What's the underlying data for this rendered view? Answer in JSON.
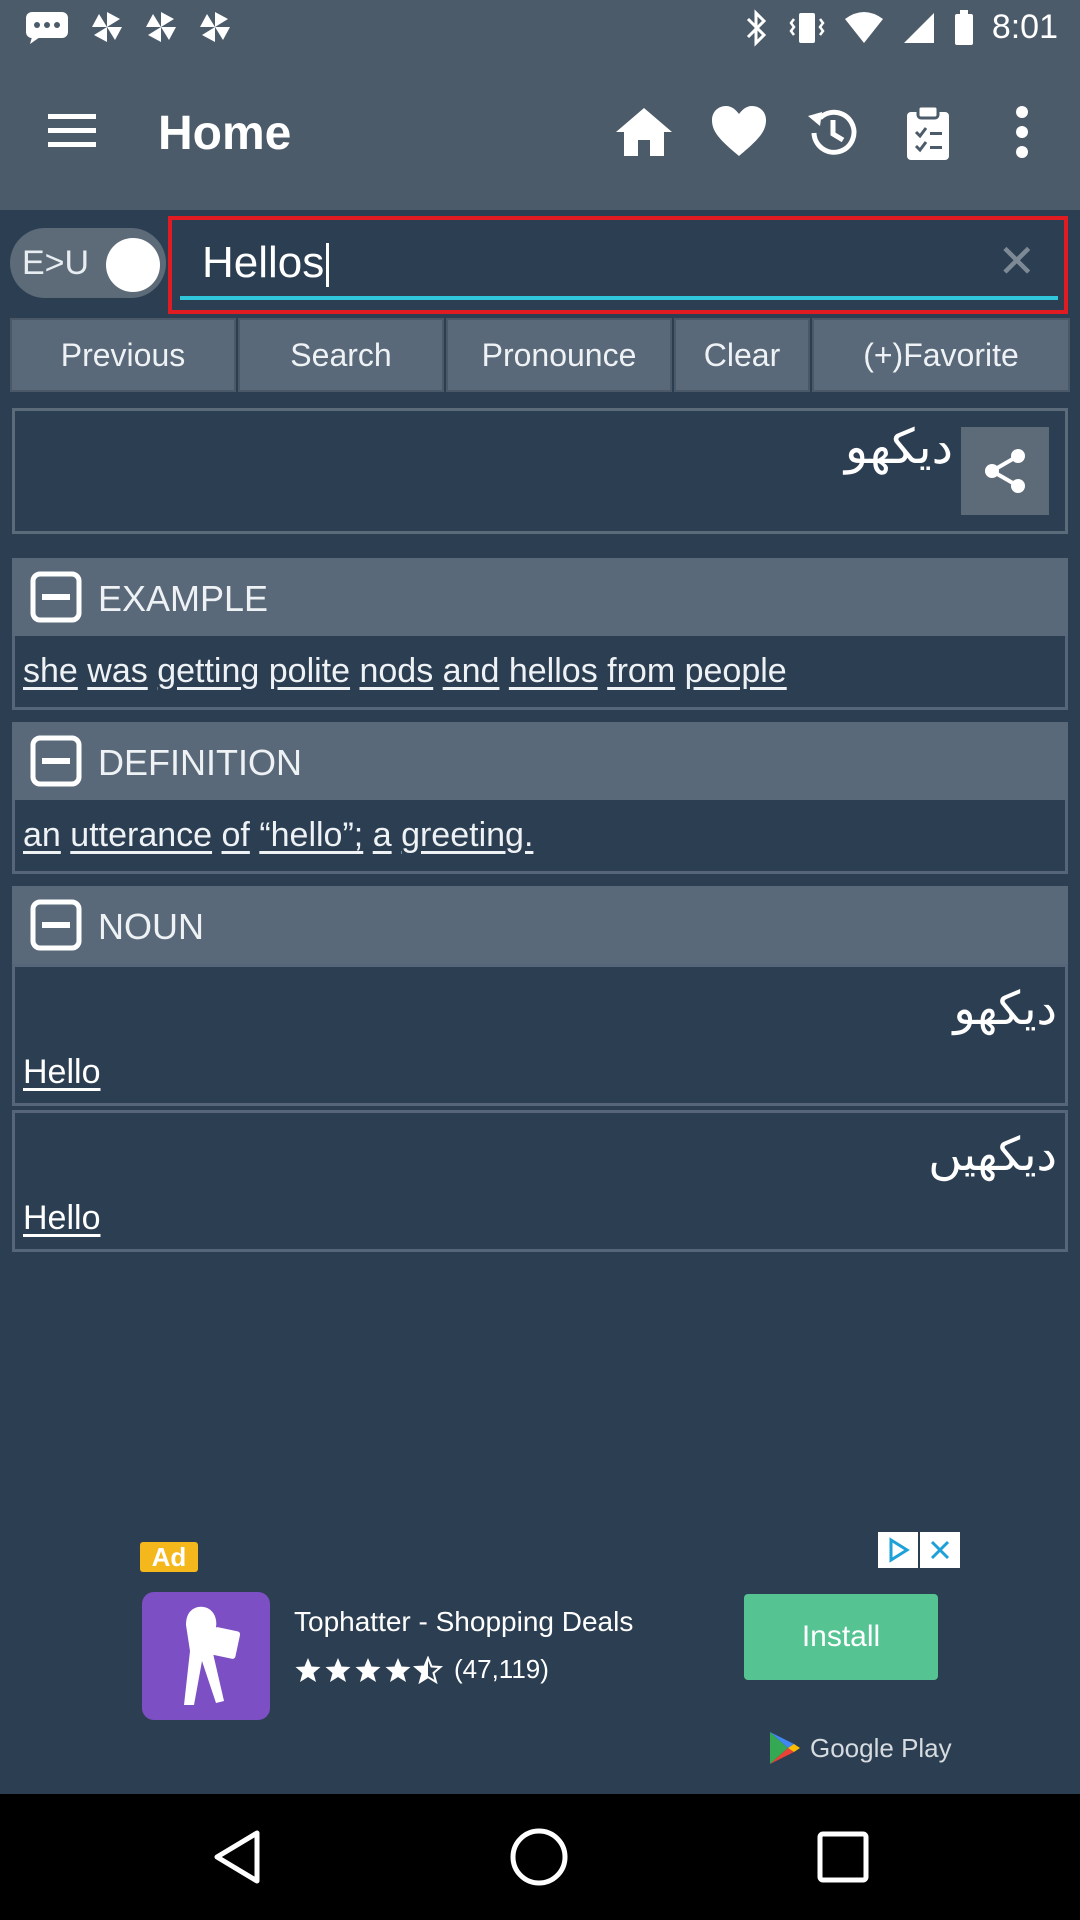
{
  "status_bar": {
    "time": "8:01",
    "left_icons": [
      "message-icon",
      "pinwheel-icon",
      "pinwheel-icon",
      "pinwheel-icon"
    ],
    "right_icons": [
      "bluetooth-icon",
      "vibrate-icon",
      "wifi-icon",
      "signal-icon",
      "battery-icon"
    ]
  },
  "app_bar": {
    "title": "Home",
    "icons": [
      "menu-icon",
      "home-icon",
      "heart-icon",
      "history-icon",
      "clipboard-icon",
      "more-vert-icon"
    ]
  },
  "toggle": {
    "label": "E>U"
  },
  "search": {
    "value": "Hellos"
  },
  "buttons": [
    {
      "label": "Previous"
    },
    {
      "label": "Search"
    },
    {
      "label": "Pronounce"
    },
    {
      "label": "Clear"
    },
    {
      "label": "(+)Favorite"
    }
  ],
  "result": {
    "urdu": "دیکھو"
  },
  "sections": {
    "example": {
      "title": "EXAMPLE",
      "words": [
        "she",
        "was",
        "getting",
        "polite",
        "nods",
        "and",
        "hellos",
        "from",
        "people"
      ]
    },
    "definition": {
      "title": "DEFINITION",
      "words": [
        "an",
        "utterance",
        "of",
        "“hello”;",
        "a",
        "greeting."
      ]
    },
    "noun": {
      "title": "NOUN",
      "items": [
        {
          "urdu": "دیکھو",
          "english": "Hello"
        },
        {
          "urdu": "دیکھیں",
          "english": "Hello"
        }
      ]
    }
  },
  "ad": {
    "badge": "Ad",
    "title": "Tophatter - Shopping Deals",
    "rating_count": "(47,119)",
    "rating": 4.5,
    "install_label": "Install",
    "store_label": "Google Play"
  },
  "colors": {
    "app_bar": "#4c5b6a",
    "background": "#2c3e52",
    "button": "#5a6979",
    "search_highlight": "#e01b22",
    "input_underline": "#30c7dd",
    "install": "#55c492"
  }
}
